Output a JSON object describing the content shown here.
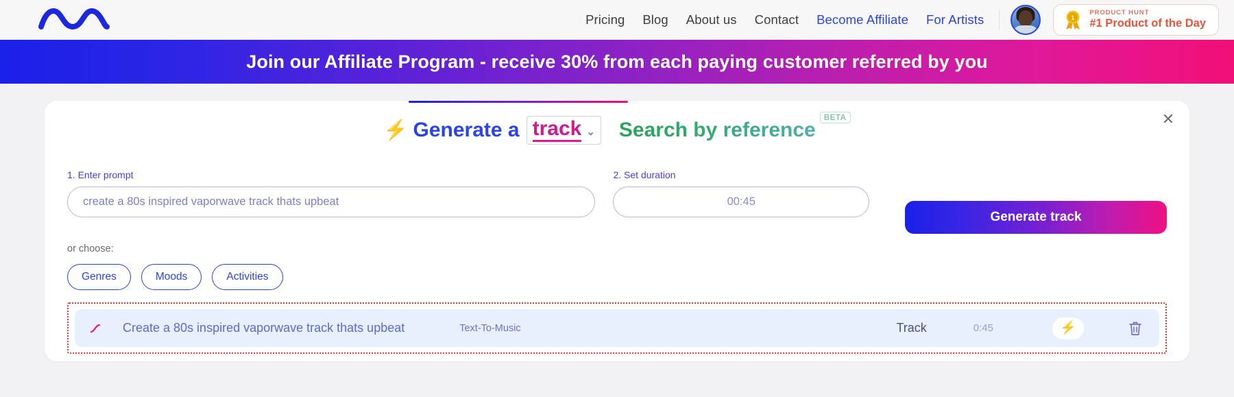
{
  "nav": {
    "logo_icon": "wave-logo-icon",
    "links": [
      {
        "label": "Pricing",
        "accent": false
      },
      {
        "label": "Blog",
        "accent": false
      },
      {
        "label": "About us",
        "accent": false
      },
      {
        "label": "Contact",
        "accent": false
      },
      {
        "label": "Become Affiliate",
        "accent": true
      },
      {
        "label": "For Artists",
        "accent": true
      }
    ],
    "product_hunt": {
      "kicker": "PRODUCT HUNT",
      "title": "#1 Product of the Day",
      "medal_icon": "medal-icon"
    }
  },
  "promo": {
    "text": "Join our Affiliate Program - receive 30% from each paying customer referred by you"
  },
  "modal": {
    "close_label": "✕",
    "tabs": {
      "generate": {
        "bolt_icon": "⚡",
        "prefix": "Generate a",
        "selected_option": "track",
        "caret_icon": "⌄"
      },
      "search": {
        "label": "Search by reference",
        "badge": "BETA"
      }
    },
    "form": {
      "prompt": {
        "label": "1. Enter prompt",
        "placeholder": "create a 80s inspired vaporwave track thats upbeat",
        "value": ""
      },
      "duration": {
        "label": "2. Set duration",
        "value": "00:45"
      },
      "generate_button": "Generate track",
      "or_choose": "or choose:",
      "chips": [
        "Genres",
        "Moods",
        "Activities"
      ]
    },
    "track": {
      "waveform_icon": "waveform-icon",
      "title": "Create a 80s inspired vaporwave track thats upbeat",
      "type": "Text-To-Music",
      "kind": "Track",
      "duration": "0:45",
      "action_icon": "⚡",
      "delete_icon": "trash-icon"
    }
  },
  "colors": {
    "brand_blue": "#2b44e8",
    "brand_pink": "#f20f77",
    "green": "#2aa35a",
    "highlight_red": "#e03b2f"
  }
}
